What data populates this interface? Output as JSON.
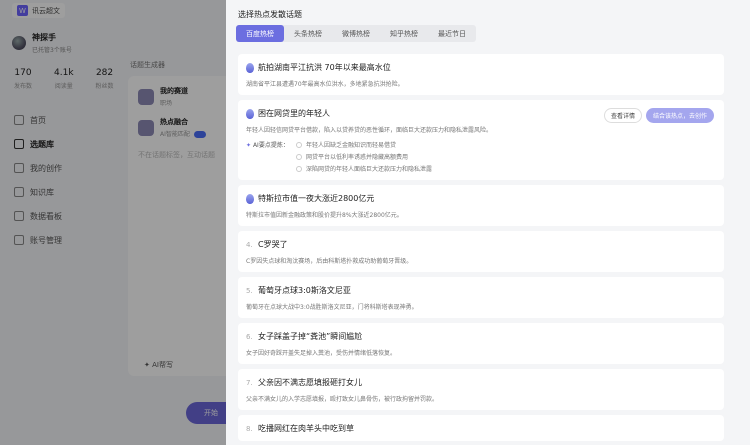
{
  "app": {
    "logo_text": "讯云超文",
    "user": {
      "name": "神探手",
      "sub": "已托管3个账号"
    },
    "stats": [
      {
        "value": "170",
        "label": "发布数"
      },
      {
        "value": "4.1k",
        "label": "阅读量"
      },
      {
        "value": "282",
        "label": "粉丝数"
      }
    ],
    "nav": [
      {
        "label": "首页",
        "icon": "home-icon"
      },
      {
        "label": "选题库",
        "icon": "library-icon"
      },
      {
        "label": "我的创作",
        "icon": "edit-icon"
      },
      {
        "label": "知识库",
        "icon": "knowledge-icon"
      },
      {
        "label": "数据看板",
        "icon": "chart-icon"
      },
      {
        "label": "账号管理",
        "icon": "account-icon"
      }
    ],
    "main_label": "话题生成器",
    "card_a": {
      "title1": "我的赛道",
      "sub1": "职场",
      "title2": "热点融合",
      "toggle_label": "AI智能匹配",
      "placeholder": "不在话题标签，互动话题",
      "footer": "AI帮写"
    },
    "start_label": "开始"
  },
  "drawer": {
    "title": "选择热点发散话题",
    "tabs": [
      "百度热榜",
      "头条热榜",
      "微博热榜",
      "知乎热榜",
      "最近节日"
    ],
    "active_tab": 0,
    "btn_detail": "查看详情",
    "btn_create": "结合该热点，去创作",
    "ai_label": "AI要点提炼：",
    "items": [
      {
        "rank": "1.",
        "title": "航拍湖南平江抗洪 70年以来最高水位",
        "desc": "湖南省平江县遭遇70年最高水位洪水，多地紧急抗洪抢险。"
      },
      {
        "rank": "2.",
        "title": "困在网贷里的年轻人",
        "desc": "年轻人因轻信网贷平台借款，陷入以贷养贷的恶性循环，面临巨大还款压力和隐私泄露风险。",
        "ai_points": [
          "年轻人因缺乏金融知识而轻易借贷",
          "网贷平台以低利率诱惑并隐藏高额费用",
          "深陷网贷的年轻人面临巨大还款压力和隐私泄露"
        ]
      },
      {
        "rank": "3.",
        "title": "特斯拉市值一夜大涨近2800亿元",
        "desc": "特斯拉市值因新金融政策和股价提升8%大涨近2800亿元。"
      },
      {
        "rank": "4.",
        "title": "C罗哭了",
        "desc": "C罗因失点球和淘汰赛场，后由科斯塔扑救成功助葡萄牙晋级。"
      },
      {
        "rank": "5.",
        "title": "葡萄牙点球3:0斯洛文尼亚",
        "desc": "葡萄牙在点球大战中3:0战胜斯洛文尼亚，门将科斯塔表现神勇。"
      },
      {
        "rank": "6.",
        "title": "女子踩盖子掉“粪池”瞬间尴尬",
        "desc": "女子因好奇踩开盖失足掉入粪池，受伤并情绪低落恢复。"
      },
      {
        "rank": "7.",
        "title": "父亲因不满志愿填报砸打女儿",
        "desc": "父亲不满女儿的入学志愿填报，殴打致女儿鼻骨伤，被行政拘留并罚款。"
      },
      {
        "rank": "8.",
        "title": "吃播网红在肉羊头中吃到草",
        "desc": ""
      }
    ]
  }
}
